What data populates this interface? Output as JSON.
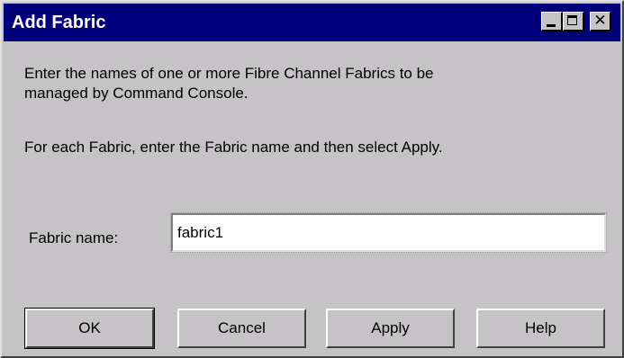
{
  "window": {
    "title": "Add Fabric",
    "controls": {
      "minimize_icon": "minimize-icon",
      "maximize_icon": "maximize-icon",
      "close_icon": "close-icon",
      "close_glyph": "✕"
    }
  },
  "instructions": {
    "line1": "Enter the names of one or more Fibre Channel Fabrics to be",
    "line2": "managed by Command Console.",
    "line3": "For each Fabric, enter the Fabric name and then select Apply."
  },
  "form": {
    "fabric_label": "Fabric name:",
    "fabric_value": "fabric1"
  },
  "buttons": {
    "ok": "OK",
    "cancel": "Cancel",
    "apply": "Apply",
    "help": "Help"
  },
  "colors": {
    "titlebar": "#00007b",
    "face": "#c6c3c6"
  }
}
